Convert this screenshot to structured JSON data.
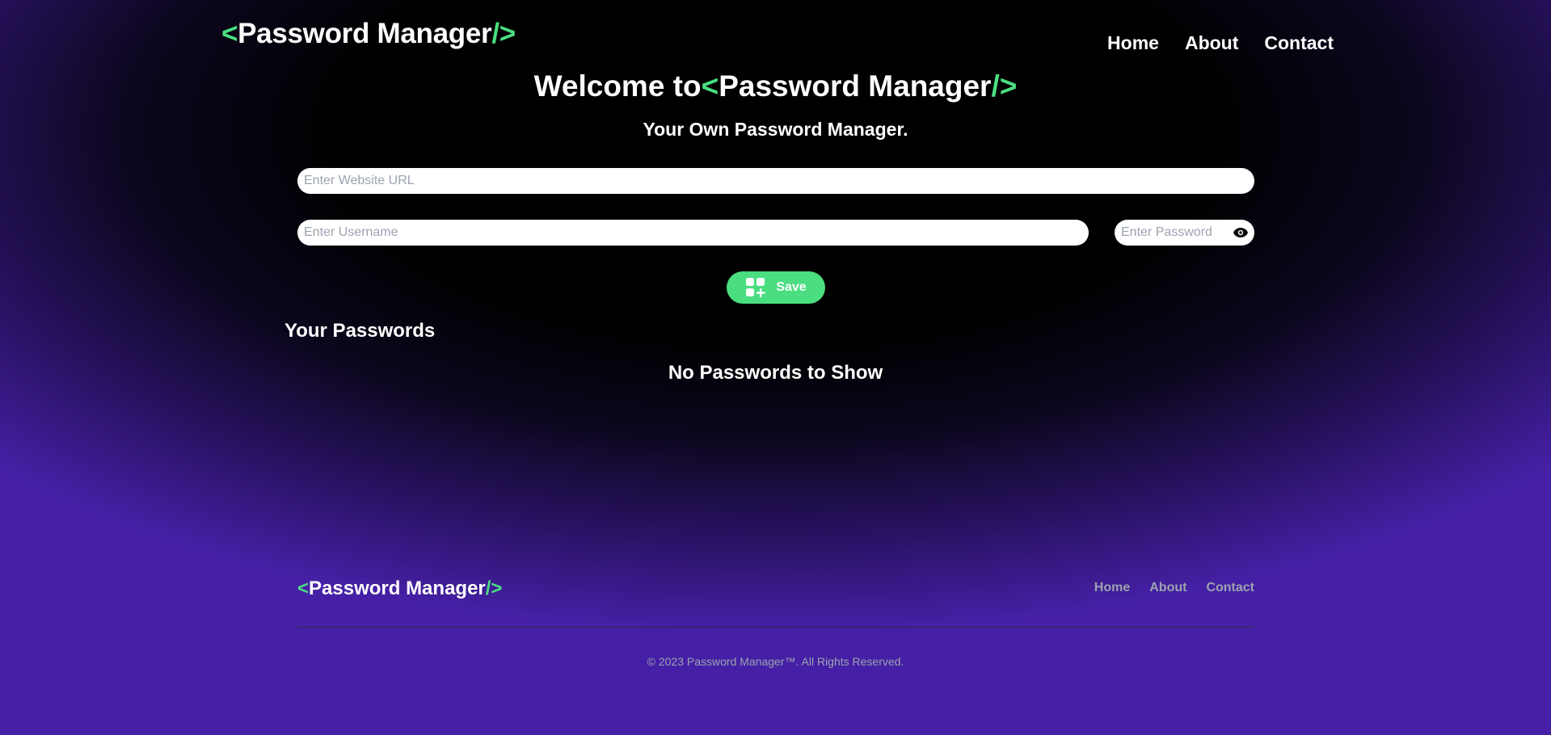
{
  "header": {
    "logo": {
      "open": "<",
      "name": "Password Manager",
      "close": "/>"
    },
    "nav": [
      "Home",
      "About",
      "Contact"
    ]
  },
  "hero": {
    "title_prefix": "Welcome to",
    "logo": {
      "open": "<",
      "name": "Password Manager",
      "close": "/>"
    },
    "subtitle": "Your Own Password Manager."
  },
  "form": {
    "url_placeholder": "Enter Website URL",
    "username_placeholder": "Enter Username",
    "password_placeholder": "Enter Password",
    "save_label": "Save",
    "eye_icon": "eye-icon",
    "save_icon": "grid-plus-icon"
  },
  "passwords": {
    "title": "Your Passwords",
    "empty_message": "No Passwords to Show"
  },
  "footer": {
    "logo": {
      "open": "<",
      "name": "Password Manager",
      "close": "/>"
    },
    "nav": [
      "Home",
      "About",
      "Contact"
    ],
    "copyright": "© 2023 Password Manager™. All Rights Reserved."
  },
  "colors": {
    "accent": "#4ade80",
    "background_dark": "#000000",
    "background_glow": "#4520a6",
    "muted_text": "#9ca3af"
  }
}
